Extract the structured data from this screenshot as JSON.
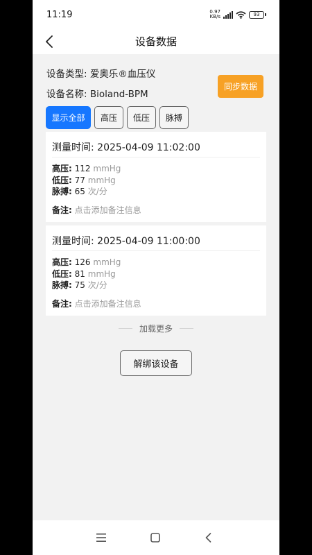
{
  "status_bar": {
    "time": "11:19",
    "net_speed_value": "0.97",
    "net_speed_unit": "KB/s",
    "battery": "93"
  },
  "header": {
    "title": "设备数据"
  },
  "device": {
    "type_line": "设备类型: 爱奥乐®血压仪",
    "name_line": "设备名称: Bioland-BPM",
    "sync_label": "同步数据"
  },
  "filters": [
    {
      "label": "显示全部",
      "active": true
    },
    {
      "label": "高压",
      "active": false
    },
    {
      "label": "低压",
      "active": false
    },
    {
      "label": "脉搏",
      "active": false
    }
  ],
  "records": [
    {
      "time_line": "测量时间: 2025-04-09 11:02:00",
      "systolic_label": "高压:",
      "systolic_value": "112",
      "systolic_unit": "mmHg",
      "diastolic_label": "低压:",
      "diastolic_value": "77",
      "diastolic_unit": "mmHg",
      "pulse_label": "脉搏:",
      "pulse_value": "65",
      "pulse_unit": "次/分",
      "note_label": "备注:",
      "note_placeholder": "点击添加备注信息"
    },
    {
      "time_line": "测量时间: 2025-04-09 11:00:00",
      "systolic_label": "高压:",
      "systolic_value": "126",
      "systolic_unit": "mmHg",
      "diastolic_label": "低压:",
      "diastolic_value": "81",
      "diastolic_unit": "mmHg",
      "pulse_label": "脉搏:",
      "pulse_value": "75",
      "pulse_unit": "次/分",
      "note_label": "备注:",
      "note_placeholder": "点击添加备注信息"
    }
  ],
  "load_more": "加载更多",
  "unbind_label": "解绑该设备",
  "colors": {
    "accent_blue": "#1677ff",
    "sync_orange": "#f7a125",
    "background": "#f2f2f2"
  },
  "icons": {
    "back": "back-chevron-icon",
    "signal": "signal-icon",
    "wifi": "wifi-icon",
    "menu": "menu-icon",
    "home": "home-square-icon",
    "system_back": "system-back-icon"
  }
}
